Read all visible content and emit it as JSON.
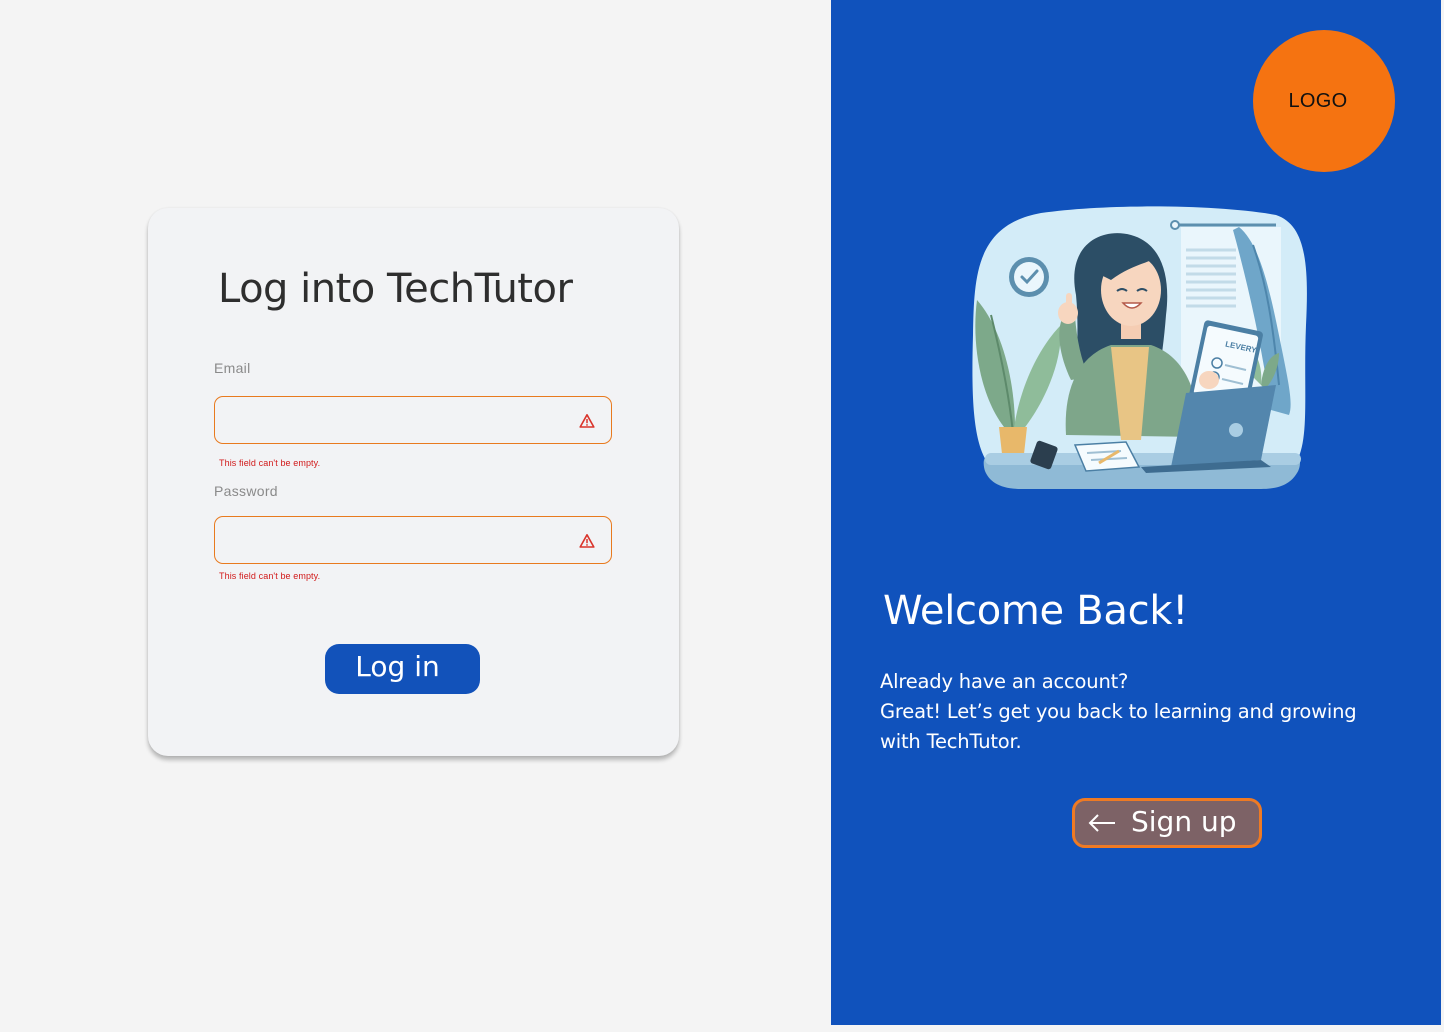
{
  "login_card": {
    "title": "Log into TechTutor",
    "email": {
      "label": "Email",
      "value": "",
      "error": "This field can't be empty."
    },
    "password": {
      "label": "Password",
      "value": "",
      "error": "This field can't be empty."
    },
    "submit_label": "Log in"
  },
  "welcome_panel": {
    "logo_text": "LOGO",
    "title": "Welcome Back!",
    "line1": "Already have an account?",
    "line2": "Great! Let’s get you back to learning and growing with TechTutor.",
    "signup_label": "Sign up",
    "illustration_sign_text": "LEVERY"
  },
  "colors": {
    "primary_blue": "#1052bc",
    "button_blue": "#1252ba",
    "accent_orange": "#f57311",
    "error_red": "#d11a1a",
    "field_border": "#e87a1e",
    "signup_button_bg": "#7d6266"
  },
  "icons": {
    "field_status": "warning-triangle-icon",
    "signup": "arrow-left-icon"
  }
}
